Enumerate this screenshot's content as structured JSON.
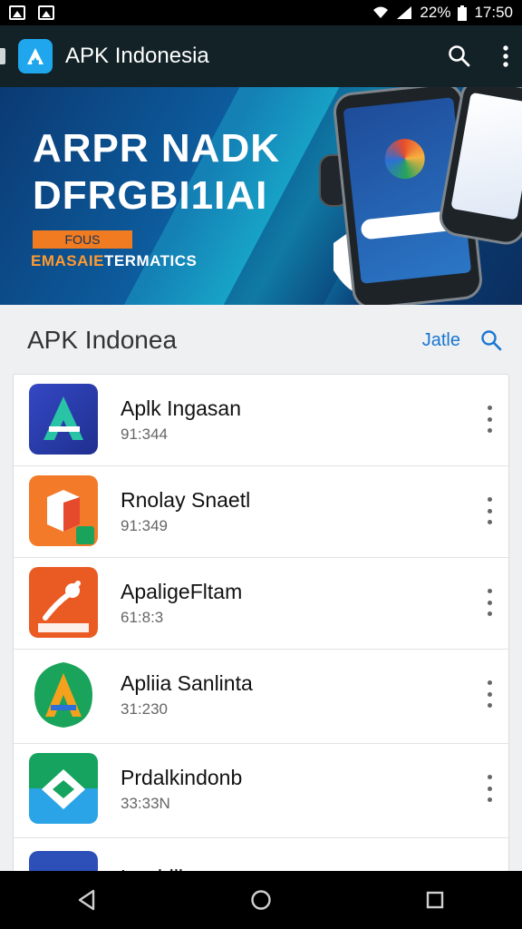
{
  "status_bar": {
    "battery": "22%",
    "time": "17:50",
    "icons": [
      "image-icon",
      "image-icon",
      "signal-icon",
      "battery-icon"
    ]
  },
  "app_bar": {
    "title": "APK Indonesia",
    "icons": [
      "app-logo-icon",
      "search-icon",
      "more-vertical-icon"
    ]
  },
  "banner": {
    "headline": "ARPR NADK\nDFRGBI1IAI",
    "tag": "FOUS",
    "subline_a": "EMASAIE",
    "subline_b": "TERMATICS"
  },
  "section": {
    "title": "APK Indonea",
    "link": "Jatle",
    "icon": "search-icon"
  },
  "apps": [
    {
      "name": "Aplk Ingasan",
      "meta": "91:344",
      "icon": "android-a-icon",
      "color": "#2a3fa8"
    },
    {
      "name": "Rnolay Snaetl",
      "meta": "91:349",
      "icon": "box-icon",
      "color": "#f27a29"
    },
    {
      "name": "ApaligeFltam",
      "meta": "61:8:3",
      "icon": "plug-icon",
      "color": "#ea5b23"
    },
    {
      "name": "Apliia Sanlinta",
      "meta": "31:230",
      "icon": "a-leaf-icon",
      "color": "#1aa35a"
    },
    {
      "name": "Prdalkindonb",
      "meta": "33:33N",
      "icon": "diamond-icon",
      "color": "#16a35f"
    },
    {
      "name": "Lroddlin",
      "meta": "",
      "icon": "circle-icon",
      "color": "#2c4fb8"
    }
  ],
  "nav": {
    "icons": [
      "back-icon",
      "home-icon",
      "recents-icon"
    ]
  }
}
